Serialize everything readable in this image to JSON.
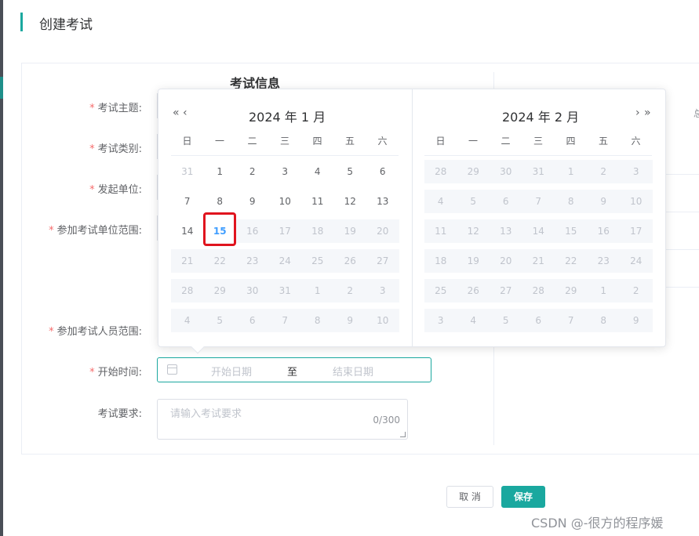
{
  "page": {
    "title": "创建考试"
  },
  "section": {
    "title": "考试信息"
  },
  "form": {
    "fields": [
      {
        "label": "考试主题:",
        "required": true
      },
      {
        "label": "考试类别:",
        "required": true
      },
      {
        "label": "发起单位:",
        "required": true
      },
      {
        "label": "参加考试单位范围:",
        "required": true
      },
      {
        "label": "参加考试人员范围:",
        "required": true
      },
      {
        "label": "开始时间:",
        "required": true
      },
      {
        "label": "考试要求:",
        "required": false
      }
    ],
    "required_mark": "*",
    "date_range": {
      "start_placeholder": "开始日期",
      "separator": "至",
      "end_placeholder": "结束日期"
    },
    "requirement": {
      "placeholder": "请输入考试要求",
      "count": "0/300"
    }
  },
  "picker": {
    "prev_year": "«",
    "prev_month": "‹",
    "next_month": "›",
    "next_year": "»",
    "weekdays": [
      "日",
      "一",
      "二",
      "三",
      "四",
      "五",
      "六"
    ],
    "left": {
      "title": "2024 年 1 月",
      "weeks": [
        [
          {
            "d": "31",
            "t": "prev"
          },
          {
            "d": "1",
            "t": "cur"
          },
          {
            "d": "2",
            "t": "cur"
          },
          {
            "d": "3",
            "t": "cur"
          },
          {
            "d": "4",
            "t": "cur"
          },
          {
            "d": "5",
            "t": "cur"
          },
          {
            "d": "6",
            "t": "cur"
          }
        ],
        [
          {
            "d": "7",
            "t": "cur"
          },
          {
            "d": "8",
            "t": "cur"
          },
          {
            "d": "9",
            "t": "cur"
          },
          {
            "d": "10",
            "t": "cur"
          },
          {
            "d": "11",
            "t": "cur"
          },
          {
            "d": "12",
            "t": "cur"
          },
          {
            "d": "13",
            "t": "cur"
          }
        ],
        [
          {
            "d": "14",
            "t": "cur"
          },
          {
            "d": "15",
            "t": "today"
          },
          {
            "d": "16",
            "t": "disabled"
          },
          {
            "d": "17",
            "t": "disabled"
          },
          {
            "d": "18",
            "t": "disabled"
          },
          {
            "d": "19",
            "t": "disabled"
          },
          {
            "d": "20",
            "t": "disabled"
          }
        ],
        [
          {
            "d": "21",
            "t": "disabled"
          },
          {
            "d": "22",
            "t": "disabled"
          },
          {
            "d": "23",
            "t": "disabled"
          },
          {
            "d": "24",
            "t": "disabled"
          },
          {
            "d": "25",
            "t": "disabled"
          },
          {
            "d": "26",
            "t": "disabled"
          },
          {
            "d": "27",
            "t": "disabled"
          }
        ],
        [
          {
            "d": "28",
            "t": "disabled"
          },
          {
            "d": "29",
            "t": "disabled"
          },
          {
            "d": "30",
            "t": "disabled"
          },
          {
            "d": "31",
            "t": "disabled"
          },
          {
            "d": "1",
            "t": "disabled"
          },
          {
            "d": "2",
            "t": "disabled"
          },
          {
            "d": "3",
            "t": "disabled"
          }
        ],
        [
          {
            "d": "4",
            "t": "disabled"
          },
          {
            "d": "5",
            "t": "disabled"
          },
          {
            "d": "6",
            "t": "disabled"
          },
          {
            "d": "7",
            "t": "disabled"
          },
          {
            "d": "8",
            "t": "disabled"
          },
          {
            "d": "9",
            "t": "disabled"
          },
          {
            "d": "10",
            "t": "disabled"
          }
        ]
      ]
    },
    "right": {
      "title": "2024 年 2 月",
      "weeks": [
        [
          {
            "d": "28",
            "t": "disabled"
          },
          {
            "d": "29",
            "t": "disabled"
          },
          {
            "d": "30",
            "t": "disabled"
          },
          {
            "d": "31",
            "t": "disabled"
          },
          {
            "d": "1",
            "t": "disabled"
          },
          {
            "d": "2",
            "t": "disabled"
          },
          {
            "d": "3",
            "t": "disabled"
          }
        ],
        [
          {
            "d": "4",
            "t": "disabled"
          },
          {
            "d": "5",
            "t": "disabled"
          },
          {
            "d": "6",
            "t": "disabled"
          },
          {
            "d": "7",
            "t": "disabled"
          },
          {
            "d": "8",
            "t": "disabled"
          },
          {
            "d": "9",
            "t": "disabled"
          },
          {
            "d": "10",
            "t": "disabled"
          }
        ],
        [
          {
            "d": "11",
            "t": "disabled"
          },
          {
            "d": "12",
            "t": "disabled"
          },
          {
            "d": "13",
            "t": "disabled"
          },
          {
            "d": "14",
            "t": "disabled"
          },
          {
            "d": "15",
            "t": "disabled"
          },
          {
            "d": "16",
            "t": "disabled"
          },
          {
            "d": "17",
            "t": "disabled"
          }
        ],
        [
          {
            "d": "18",
            "t": "disabled"
          },
          {
            "d": "19",
            "t": "disabled"
          },
          {
            "d": "20",
            "t": "disabled"
          },
          {
            "d": "21",
            "t": "disabled"
          },
          {
            "d": "22",
            "t": "disabled"
          },
          {
            "d": "23",
            "t": "disabled"
          },
          {
            "d": "24",
            "t": "disabled"
          }
        ],
        [
          {
            "d": "25",
            "t": "disabled"
          },
          {
            "d": "26",
            "t": "disabled"
          },
          {
            "d": "27",
            "t": "disabled"
          },
          {
            "d": "28",
            "t": "disabled"
          },
          {
            "d": "29",
            "t": "disabled"
          },
          {
            "d": "1",
            "t": "disabled"
          },
          {
            "d": "2",
            "t": "disabled"
          }
        ],
        [
          {
            "d": "3",
            "t": "disabled"
          },
          {
            "d": "4",
            "t": "disabled"
          },
          {
            "d": "5",
            "t": "disabled"
          },
          {
            "d": "6",
            "t": "disabled"
          },
          {
            "d": "7",
            "t": "disabled"
          },
          {
            "d": "8",
            "t": "disabled"
          },
          {
            "d": "9",
            "t": "disabled"
          }
        ]
      ]
    }
  },
  "actions": {
    "cancel": "取 消",
    "save": "保存"
  },
  "watermark": "CSDN @-很方的程序媛",
  "edge_glyph": "总",
  "colors": {
    "accent": "#1aa89f",
    "today": "#409eff",
    "required": "#f56c6c",
    "highlight_ring": "#e0141e",
    "disabled_bg": "#f5f7fa"
  },
  "icons": {
    "date_input": "calendar-icon"
  }
}
